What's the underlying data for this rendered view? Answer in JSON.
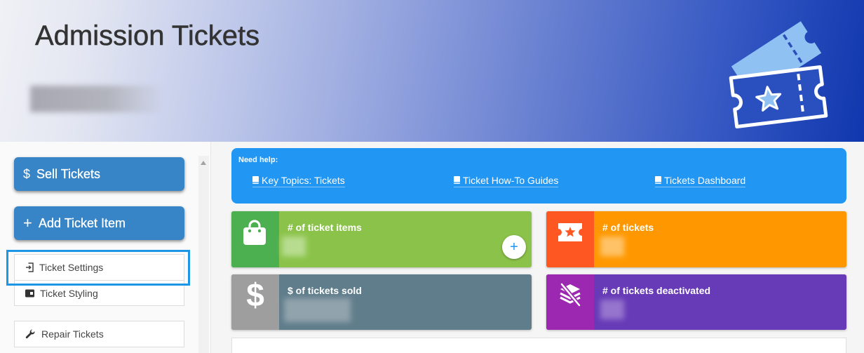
{
  "header": {
    "title": "Admission Tickets",
    "illustration_icon": "admission-ticket-icon"
  },
  "sidebar": {
    "sell_button": {
      "icon": "dollar-icon",
      "glyph": "$",
      "label": "Sell Tickets"
    },
    "add_button": {
      "icon": "plus-icon",
      "glyph": "+",
      "label": "Add Ticket Item"
    },
    "items": [
      {
        "icon": "sign-in-icon",
        "label": "Ticket Settings",
        "highlighted": true
      },
      {
        "icon": "wallet-icon",
        "label": "Ticket Styling",
        "highlighted": false
      },
      {
        "icon": "wrench-icon",
        "label": "Repair Tickets",
        "highlighted": false
      }
    ]
  },
  "help": {
    "title": "Need help:",
    "links": [
      {
        "icon": "book-icon",
        "label": "Key Topics: Tickets"
      },
      {
        "icon": "book-icon",
        "label": "Ticket How-To Guides"
      },
      {
        "icon": "book-icon",
        "label": "Tickets Dashboard"
      }
    ]
  },
  "stats": [
    {
      "label": "# of ticket items",
      "icon": "shopping-bag-icon",
      "icon_color": "#4caf50",
      "color": "#8bc34a",
      "add_glyph": "+"
    },
    {
      "label": "# of tickets",
      "icon": "ticket-star-icon",
      "icon_color": "#ff5722",
      "color": "#ff9800"
    },
    {
      "label": "$ of tickets sold",
      "icon": "dollar-icon",
      "glyph": "$",
      "icon_color": "#9e9e9e",
      "color": "#607d8b"
    },
    {
      "label": "# of tickets deactivated",
      "icon": "layers-slash-icon",
      "icon_color": "#9c27b0",
      "color": "#673ab7"
    }
  ],
  "colors": {
    "header_title": "#333333",
    "sidebar_button": "#3784c6",
    "help_panel": "#2196f3",
    "highlight": "#1e96e6"
  }
}
